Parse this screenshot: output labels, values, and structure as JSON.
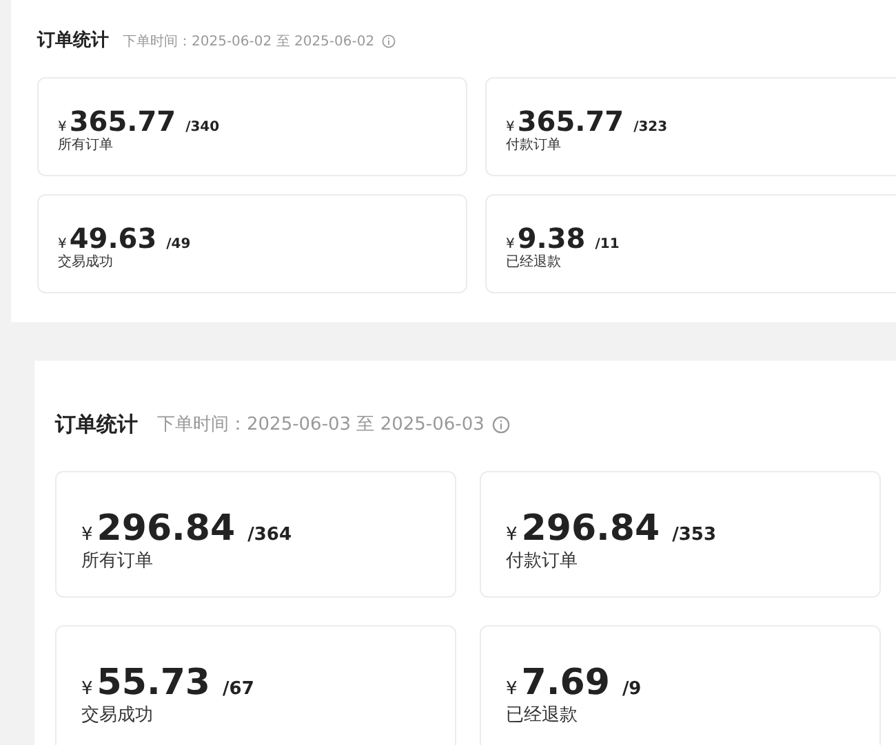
{
  "panels": [
    {
      "title": "订单统计",
      "time": "下单时间：2025-06-02 至 2025-06-02",
      "cards": [
        {
          "currency": "¥",
          "amount": "365.77",
          "count": "/340",
          "label": "所有订单"
        },
        {
          "currency": "¥",
          "amount": "365.77",
          "count": "/323",
          "label": "付款订单"
        },
        {
          "currency": "¥",
          "amount": "49.63",
          "count": "/49",
          "label": "交易成功"
        },
        {
          "currency": "¥",
          "amount": "9.38",
          "count": "/11",
          "label": "已经退款"
        }
      ]
    },
    {
      "title": "订单统计",
      "time": "下单时间：2025-06-03 至 2025-06-03",
      "cards": [
        {
          "currency": "¥",
          "amount": "296.84",
          "count": "/364",
          "label": "所有订单"
        },
        {
          "currency": "¥",
          "amount": "296.84",
          "count": "/353",
          "label": "付款订单"
        },
        {
          "currency": "¥",
          "amount": "55.73",
          "count": "/67",
          "label": "交易成功"
        },
        {
          "currency": "¥",
          "amount": "7.69",
          "count": "/9",
          "label": "已经退款"
        }
      ]
    }
  ]
}
